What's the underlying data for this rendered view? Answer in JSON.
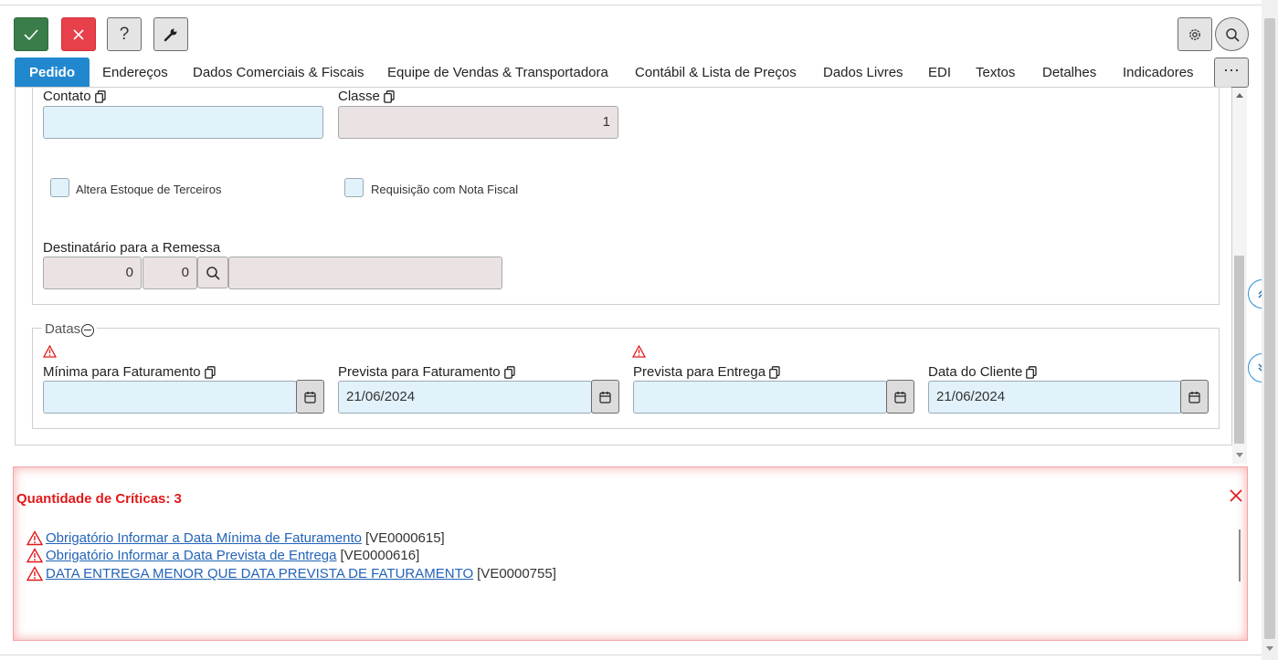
{
  "toolbar": {
    "confirm_icon": "check-icon",
    "cancel_icon": "close-icon",
    "help_label": "?",
    "tools_icon": "wrench-icon",
    "settings_icon": "gear-icon",
    "search_icon": "search-icon"
  },
  "tabs": [
    {
      "label": "Pedido",
      "active": true
    },
    {
      "label": "Endereços"
    },
    {
      "label": "Dados Comerciais & Fiscais"
    },
    {
      "label": "Equipe de Vendas & Transportadora"
    },
    {
      "label": "Contábil & Lista de Preços"
    },
    {
      "label": "Dados Livres"
    },
    {
      "label": "EDI"
    },
    {
      "label": "Textos"
    },
    {
      "label": "Detalhes"
    },
    {
      "label": "Indicadores"
    }
  ],
  "more_label": "···",
  "form": {
    "contato": {
      "label": "Contato",
      "value": ""
    },
    "classe": {
      "label": "Classe",
      "value": "1"
    },
    "altera_estoque": {
      "label": "Altera Estoque de Terceiros",
      "checked": false
    },
    "requisicao_nf": {
      "label": "Requisição com Nota Fiscal",
      "checked": false
    },
    "destinatario": {
      "label": "Destinatário para a Remessa",
      "code1": "0",
      "code2": "0",
      "name": ""
    }
  },
  "datas": {
    "legend": "Datas",
    "minima_faturamento": {
      "label": "Mínima para Faturamento",
      "value": "",
      "warning": true
    },
    "prevista_faturamento": {
      "label": "Prevista para Faturamento",
      "value": "21/06/2024",
      "warning": false
    },
    "prevista_entrega": {
      "label": "Prevista para Entrega",
      "value": "",
      "warning": true
    },
    "data_cliente": {
      "label": "Data do Cliente",
      "value": "21/06/2024",
      "warning": false
    }
  },
  "criticas": {
    "title": "Quantidade de Críticas: 3",
    "items": [
      {
        "text": "Obrigatório Informar a Data Mínima de Faturamento",
        "code": "[VE0000615]"
      },
      {
        "text": "Obrigatório Informar a Data Prevista de Entrega",
        "code": "[VE0000616]"
      },
      {
        "text": "DATA ENTREGA MENOR QUE DATA PREVISTA DE FATURAMENTO",
        "code": "[VE0000755]"
      }
    ]
  },
  "colors": {
    "accent": "#2188cf",
    "ok": "#3a7d4a",
    "cancel": "#e8404a",
    "error": "#e01919",
    "link": "#2363b8"
  }
}
